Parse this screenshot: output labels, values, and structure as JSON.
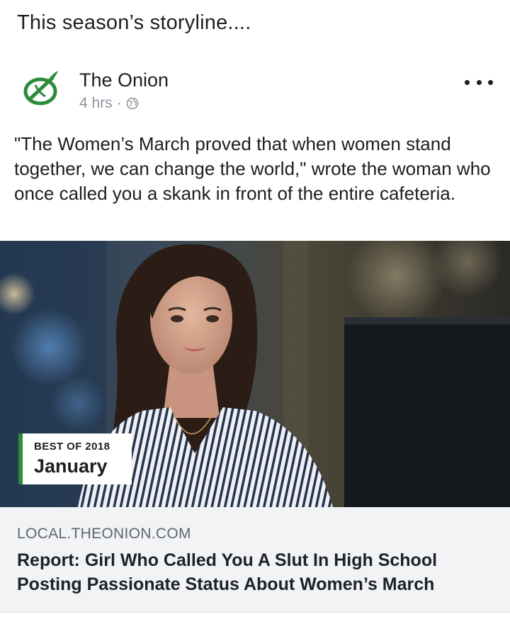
{
  "caption": "This season’s storyline....",
  "post": {
    "page_name": "The Onion",
    "time": "4 hrs",
    "separator": "·",
    "privacy_icon": "globe-icon",
    "more_icon": "more-options-icon",
    "text": "\"The Women’s March proved that when women stand together, we can change the world,\" wrote the woman who once called you a skank in front of the entire cafeteria."
  },
  "photo": {
    "badge_top": "BEST OF 2018",
    "badge_main": "January",
    "badge_color": "#2d8b3a"
  },
  "link": {
    "domain": "LOCAL.THEONION.COM",
    "title": "Report: Girl Who Called You A Slut In High School Posting Passionate Status About Women’s March"
  },
  "colors": {
    "brand_green": "#2d8b3a",
    "meta_gray": "#8d949e",
    "link_bg": "#f2f3f5"
  }
}
